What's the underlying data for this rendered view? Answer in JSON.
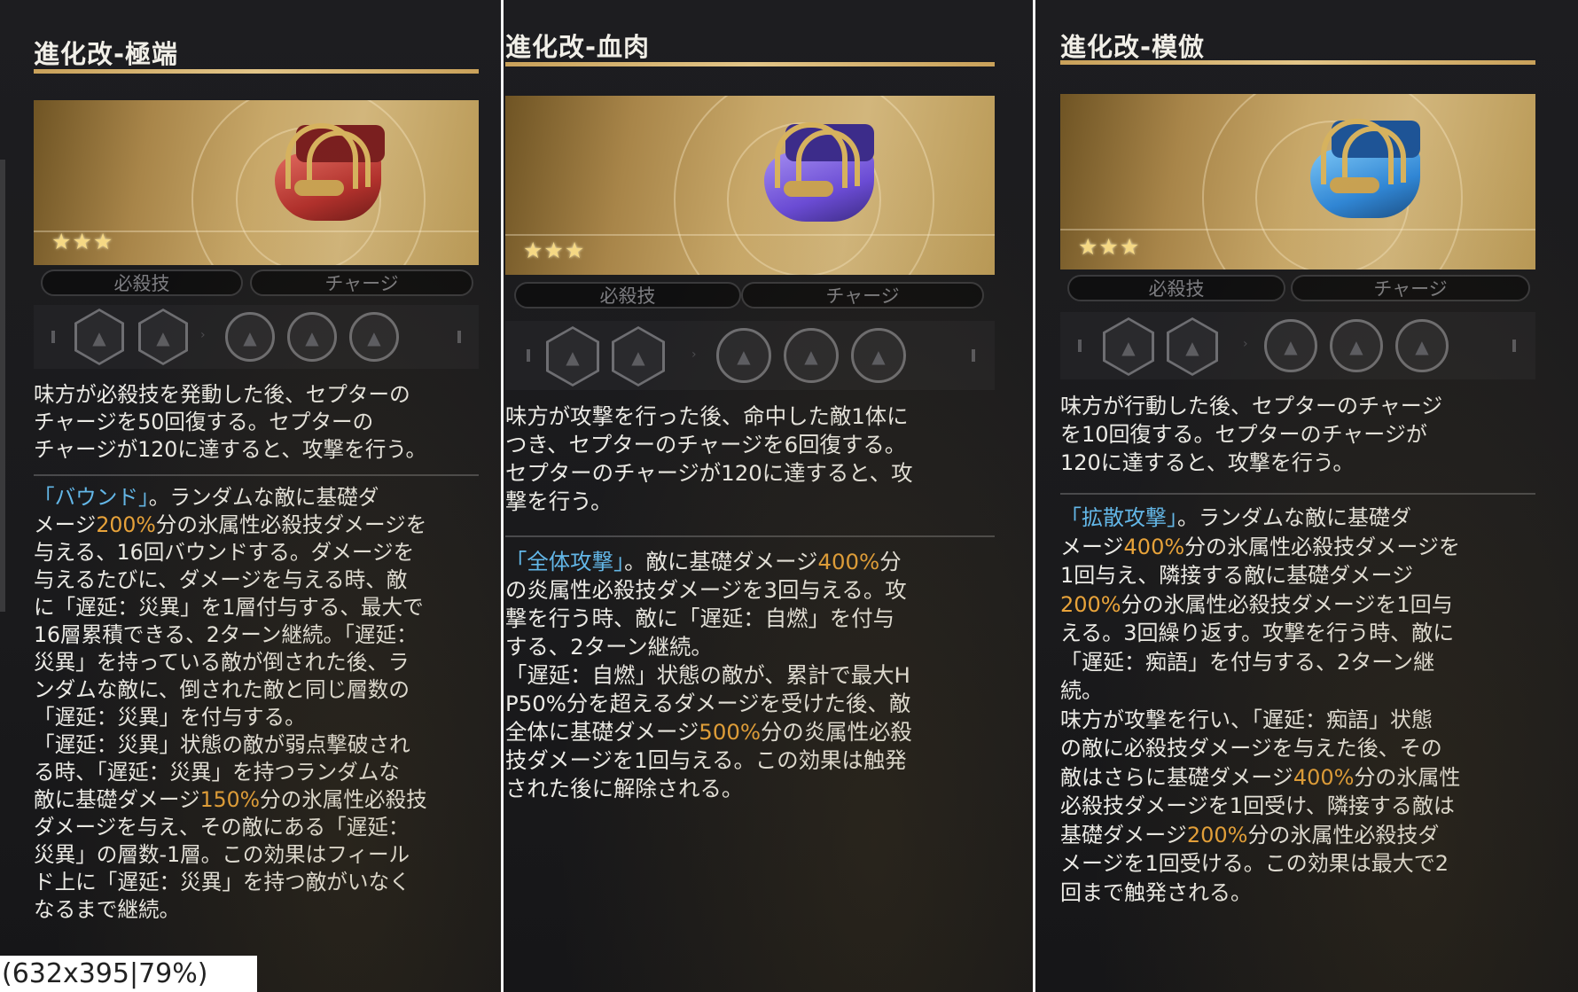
{
  "zoom_label": "(632x395|79%)",
  "panels": [
    {
      "title": "進化改-極端",
      "stars": "★★★",
      "tags": [
        "必殺技",
        "チャージ"
      ],
      "relic_color": "red",
      "desc1": "味方が必殺技を発動した後、セプターの\nチャージを50回復する。セプターの\nチャージが120に達すると、攻撃を行う。",
      "desc2": [
        {
          "t": "「バウンド」",
          "c": "blue"
        },
        {
          "t": "。ランダムな敵に基礎ダ\nメージ"
        },
        {
          "t": "200%",
          "c": "orange"
        },
        {
          "t": "分の氷属性必殺技ダメージを\n与える、16回バウンドする。ダメージを\n与えるたびに、ダメージを与える時、敵\nに「遅延：災異」を1層付与する、最大で\n16層累積できる、2ターン継続。「遅延：\n災異」を持っている敵が倒された後、ラ\nンダムな敵に、倒された敵と同じ層数の\n「遅延：災異」を付与する。\n「遅延：災異」状態の敵が弱点撃破され\nる時、「遅延：災異」を持つランダムな\n敵に基礎ダメージ"
        },
        {
          "t": "150%",
          "c": "orange"
        },
        {
          "t": "分の氷属性必殺技\nダメージを与え、その敵にある「遅延：\n災異」の層数-1層。この効果はフィール\nド上に「遅延：災異」を持つ敵がいなく\nなるまで継続。"
        }
      ]
    },
    {
      "title": "進化改-血肉",
      "stars": "★★★",
      "tags": [
        "必殺技",
        "チャージ"
      ],
      "relic_color": "purple",
      "desc1": "味方が攻撃を行った後、命中した敵1体に\nつき、セプターのチャージを6回復する。\nセプターのチャージが120に達すると、攻\n撃を行う。",
      "desc2": [
        {
          "t": "「全体攻撃」",
          "c": "blue"
        },
        {
          "t": "。敵に基礎ダメージ"
        },
        {
          "t": "400%",
          "c": "orange"
        },
        {
          "t": "分\nの炎属性必殺技ダメージを3回与える。攻\n撃を行う時、敵に「遅延：自燃」を付与\nする、2ターン継続。\n「遅延：自燃」状態の敵が、累計で最大H\nP50%分を超えるダメージを受けた後、敵\n全体に基礎ダメージ"
        },
        {
          "t": "500%",
          "c": "orange"
        },
        {
          "t": "分の炎属性必殺\n技ダメージを1回与える。この効果は触発\nされた後に解除される。"
        }
      ]
    },
    {
      "title": "進化改-模倣",
      "stars": "★★★",
      "tags": [
        "必殺技",
        "チャージ"
      ],
      "relic_color": "blue",
      "desc1": "味方が行動した後、セプターのチャージ\nを10回復する。セプターのチャージが\n120に達すると、攻撃を行う。",
      "desc2": [
        {
          "t": "「拡散攻撃」",
          "c": "blue"
        },
        {
          "t": "。ランダムな敵に基礎ダ\nメージ"
        },
        {
          "t": "400%",
          "c": "orange"
        },
        {
          "t": "分の氷属性必殺技ダメージを\n1回与え、隣接する敵に基礎ダメージ\n"
        },
        {
          "t": "200%",
          "c": "orange"
        },
        {
          "t": "分の氷属性必殺技ダメージを1回与\nえる。3回繰り返す。攻撃を行う時、敵に\n「遅延：痴語」を付与する、2ターン継\n続。\n味方が攻撃を行い、「遅延：痴語」状態\nの敵に必殺技ダメージを与えた後、その\n敵はさらに基礎ダメージ"
        },
        {
          "t": "400%",
          "c": "orange"
        },
        {
          "t": "分の氷属性\n必殺技ダメージを1回受け、隣接する敵は\n基礎ダメージ"
        },
        {
          "t": "200%",
          "c": "orange"
        },
        {
          "t": "分の氷属性必殺技ダ\nメージを1回受ける。この効果は最大で2\n回まで触発される。"
        }
      ]
    }
  ],
  "colors": {
    "accent_gold": "#d6b25e",
    "keyword_blue": "#63b7e8",
    "value_orange": "#e8a33a"
  }
}
